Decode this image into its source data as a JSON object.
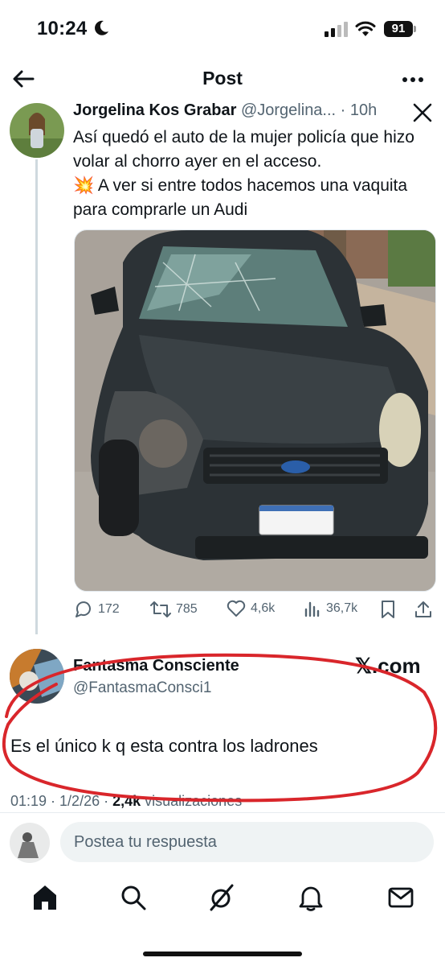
{
  "status_bar": {
    "time": "10:24",
    "battery": "91"
  },
  "header": {
    "title": "Post"
  },
  "post": {
    "author_name": "Jorgelina Kos Grabar",
    "author_handle": "@Jorgelina...",
    "time_ago": "10h",
    "text": "Así quedó el auto de la mujer policía que hizo volar al chorro ayer en el acceso.\n💥 A ver si entre todos hacemos una vaquita para comprarle un Audi",
    "stats": {
      "replies": "172",
      "reposts": "785",
      "likes": "4,6k",
      "views": "36,7k"
    }
  },
  "quoted_post": {
    "author_name": "Fantasma Consciente",
    "author_handle": "@FantasmaConsci1",
    "watermark": "𝕏.com",
    "text": "Es el único k q esta contra los ladrones",
    "timestamp": "01:19 · 1/2/26 · ",
    "views_count": "2,4k",
    "views_label": " visualizaciones"
  },
  "reply_bar": {
    "placeholder": "Postea tu respuesta"
  },
  "annotation_color": "#d9262b",
  "icons": [
    "back-arrow-icon",
    "more-icon",
    "close-x-icon",
    "reply-icon",
    "repost-icon",
    "like-icon",
    "views-icon",
    "bookmark-icon",
    "share-icon",
    "home-icon",
    "search-icon",
    "grok-icon",
    "notifications-icon",
    "messages-icon"
  ]
}
